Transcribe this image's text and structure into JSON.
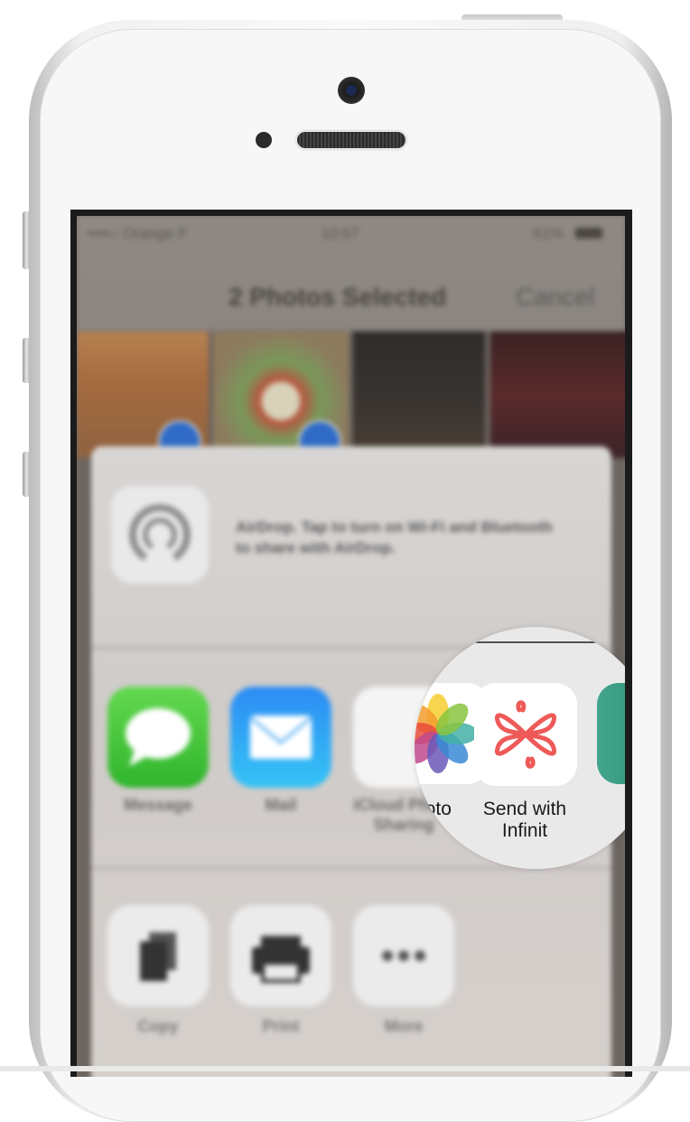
{
  "status_bar": {
    "carrier": "••••○ Orange F",
    "time": "10:57",
    "battery": "61%"
  },
  "nav": {
    "title": "2 Photos Selected",
    "cancel": "Cancel"
  },
  "airdrop": {
    "text": "AirDrop. Tap to turn on Wi-Fi and Bluetooth to share with AirDrop."
  },
  "apps": [
    {
      "label": "Message",
      "icon": "message-icon"
    },
    {
      "label": "Mail",
      "icon": "mail-icon"
    },
    {
      "label": "iCloud Photo Sharing",
      "icon": "photos-icon"
    },
    {
      "label": "Send with Infinit",
      "icon": "infinit-icon"
    }
  ],
  "actions": [
    {
      "label": "Copy",
      "icon": "copy-icon"
    },
    {
      "label": "Print",
      "icon": "print-icon"
    },
    {
      "label": "More",
      "icon": "more-icon"
    }
  ],
  "magnifier": {
    "photo_label_partial": "hoto",
    "send_label": "Send with Infinit"
  }
}
